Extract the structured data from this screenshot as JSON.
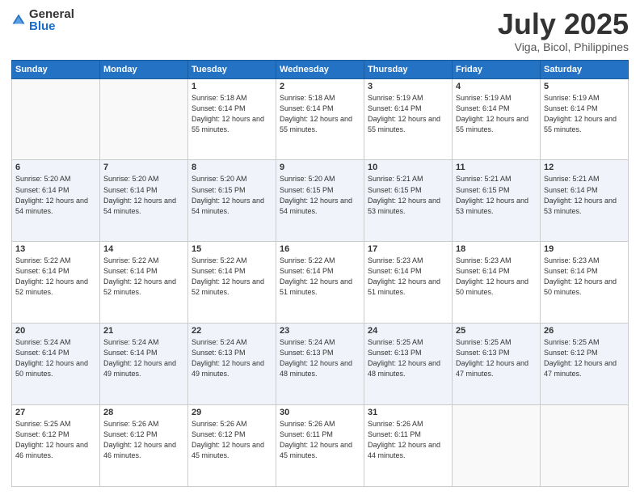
{
  "header": {
    "logo_general": "General",
    "logo_blue": "Blue",
    "month": "July 2025",
    "location": "Viga, Bicol, Philippines"
  },
  "weekdays": [
    "Sunday",
    "Monday",
    "Tuesday",
    "Wednesday",
    "Thursday",
    "Friday",
    "Saturday"
  ],
  "weeks": [
    [
      {
        "day": "",
        "sunrise": "",
        "sunset": "",
        "daylight": ""
      },
      {
        "day": "",
        "sunrise": "",
        "sunset": "",
        "daylight": ""
      },
      {
        "day": "1",
        "sunrise": "Sunrise: 5:18 AM",
        "sunset": "Sunset: 6:14 PM",
        "daylight": "Daylight: 12 hours and 55 minutes."
      },
      {
        "day": "2",
        "sunrise": "Sunrise: 5:18 AM",
        "sunset": "Sunset: 6:14 PM",
        "daylight": "Daylight: 12 hours and 55 minutes."
      },
      {
        "day": "3",
        "sunrise": "Sunrise: 5:19 AM",
        "sunset": "Sunset: 6:14 PM",
        "daylight": "Daylight: 12 hours and 55 minutes."
      },
      {
        "day": "4",
        "sunrise": "Sunrise: 5:19 AM",
        "sunset": "Sunset: 6:14 PM",
        "daylight": "Daylight: 12 hours and 55 minutes."
      },
      {
        "day": "5",
        "sunrise": "Sunrise: 5:19 AM",
        "sunset": "Sunset: 6:14 PM",
        "daylight": "Daylight: 12 hours and 55 minutes."
      }
    ],
    [
      {
        "day": "6",
        "sunrise": "Sunrise: 5:20 AM",
        "sunset": "Sunset: 6:14 PM",
        "daylight": "Daylight: 12 hours and 54 minutes."
      },
      {
        "day": "7",
        "sunrise": "Sunrise: 5:20 AM",
        "sunset": "Sunset: 6:14 PM",
        "daylight": "Daylight: 12 hours and 54 minutes."
      },
      {
        "day": "8",
        "sunrise": "Sunrise: 5:20 AM",
        "sunset": "Sunset: 6:15 PM",
        "daylight": "Daylight: 12 hours and 54 minutes."
      },
      {
        "day": "9",
        "sunrise": "Sunrise: 5:20 AM",
        "sunset": "Sunset: 6:15 PM",
        "daylight": "Daylight: 12 hours and 54 minutes."
      },
      {
        "day": "10",
        "sunrise": "Sunrise: 5:21 AM",
        "sunset": "Sunset: 6:15 PM",
        "daylight": "Daylight: 12 hours and 53 minutes."
      },
      {
        "day": "11",
        "sunrise": "Sunrise: 5:21 AM",
        "sunset": "Sunset: 6:15 PM",
        "daylight": "Daylight: 12 hours and 53 minutes."
      },
      {
        "day": "12",
        "sunrise": "Sunrise: 5:21 AM",
        "sunset": "Sunset: 6:14 PM",
        "daylight": "Daylight: 12 hours and 53 minutes."
      }
    ],
    [
      {
        "day": "13",
        "sunrise": "Sunrise: 5:22 AM",
        "sunset": "Sunset: 6:14 PM",
        "daylight": "Daylight: 12 hours and 52 minutes."
      },
      {
        "day": "14",
        "sunrise": "Sunrise: 5:22 AM",
        "sunset": "Sunset: 6:14 PM",
        "daylight": "Daylight: 12 hours and 52 minutes."
      },
      {
        "day": "15",
        "sunrise": "Sunrise: 5:22 AM",
        "sunset": "Sunset: 6:14 PM",
        "daylight": "Daylight: 12 hours and 52 minutes."
      },
      {
        "day": "16",
        "sunrise": "Sunrise: 5:22 AM",
        "sunset": "Sunset: 6:14 PM",
        "daylight": "Daylight: 12 hours and 51 minutes."
      },
      {
        "day": "17",
        "sunrise": "Sunrise: 5:23 AM",
        "sunset": "Sunset: 6:14 PM",
        "daylight": "Daylight: 12 hours and 51 minutes."
      },
      {
        "day": "18",
        "sunrise": "Sunrise: 5:23 AM",
        "sunset": "Sunset: 6:14 PM",
        "daylight": "Daylight: 12 hours and 50 minutes."
      },
      {
        "day": "19",
        "sunrise": "Sunrise: 5:23 AM",
        "sunset": "Sunset: 6:14 PM",
        "daylight": "Daylight: 12 hours and 50 minutes."
      }
    ],
    [
      {
        "day": "20",
        "sunrise": "Sunrise: 5:24 AM",
        "sunset": "Sunset: 6:14 PM",
        "daylight": "Daylight: 12 hours and 50 minutes."
      },
      {
        "day": "21",
        "sunrise": "Sunrise: 5:24 AM",
        "sunset": "Sunset: 6:14 PM",
        "daylight": "Daylight: 12 hours and 49 minutes."
      },
      {
        "day": "22",
        "sunrise": "Sunrise: 5:24 AM",
        "sunset": "Sunset: 6:13 PM",
        "daylight": "Daylight: 12 hours and 49 minutes."
      },
      {
        "day": "23",
        "sunrise": "Sunrise: 5:24 AM",
        "sunset": "Sunset: 6:13 PM",
        "daylight": "Daylight: 12 hours and 48 minutes."
      },
      {
        "day": "24",
        "sunrise": "Sunrise: 5:25 AM",
        "sunset": "Sunset: 6:13 PM",
        "daylight": "Daylight: 12 hours and 48 minutes."
      },
      {
        "day": "25",
        "sunrise": "Sunrise: 5:25 AM",
        "sunset": "Sunset: 6:13 PM",
        "daylight": "Daylight: 12 hours and 47 minutes."
      },
      {
        "day": "26",
        "sunrise": "Sunrise: 5:25 AM",
        "sunset": "Sunset: 6:12 PM",
        "daylight": "Daylight: 12 hours and 47 minutes."
      }
    ],
    [
      {
        "day": "27",
        "sunrise": "Sunrise: 5:25 AM",
        "sunset": "Sunset: 6:12 PM",
        "daylight": "Daylight: 12 hours and 46 minutes."
      },
      {
        "day": "28",
        "sunrise": "Sunrise: 5:26 AM",
        "sunset": "Sunset: 6:12 PM",
        "daylight": "Daylight: 12 hours and 46 minutes."
      },
      {
        "day": "29",
        "sunrise": "Sunrise: 5:26 AM",
        "sunset": "Sunset: 6:12 PM",
        "daylight": "Daylight: 12 hours and 45 minutes."
      },
      {
        "day": "30",
        "sunrise": "Sunrise: 5:26 AM",
        "sunset": "Sunset: 6:11 PM",
        "daylight": "Daylight: 12 hours and 45 minutes."
      },
      {
        "day": "31",
        "sunrise": "Sunrise: 5:26 AM",
        "sunset": "Sunset: 6:11 PM",
        "daylight": "Daylight: 12 hours and 44 minutes."
      },
      {
        "day": "",
        "sunrise": "",
        "sunset": "",
        "daylight": ""
      },
      {
        "day": "",
        "sunrise": "",
        "sunset": "",
        "daylight": ""
      }
    ]
  ]
}
